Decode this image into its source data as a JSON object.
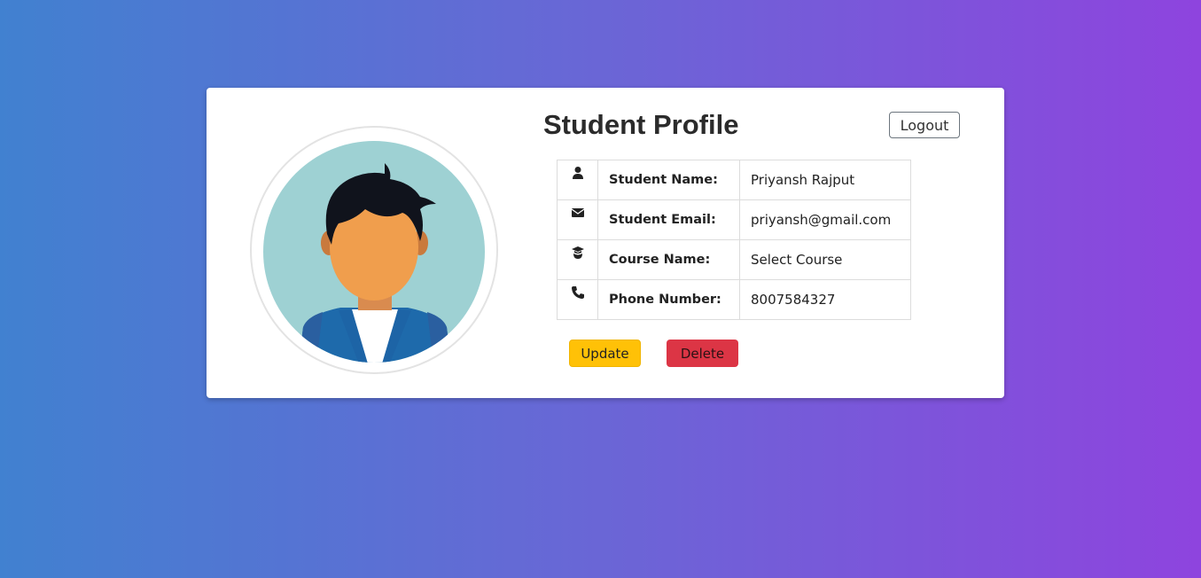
{
  "card": {
    "title": "Student Profile",
    "logout_label": "Logout"
  },
  "profile": {
    "rows": [
      {
        "icon": "user-icon",
        "label": "Student Name:",
        "value": "Priyansh Rajput"
      },
      {
        "icon": "envelope-icon",
        "label": "Student Email:",
        "value": "priyansh@gmail.com"
      },
      {
        "icon": "graduation-cap-icon",
        "label": "Course Name:",
        "value": "Select Course"
      },
      {
        "icon": "phone-icon",
        "label": "Phone Number:",
        "value": "8007584327"
      }
    ]
  },
  "actions": {
    "update_label": "Update",
    "delete_label": "Delete"
  },
  "colors": {
    "gradient_start": "#4181d0",
    "gradient_end": "#8e44de",
    "update": "#ffc107",
    "delete": "#dc3545"
  }
}
